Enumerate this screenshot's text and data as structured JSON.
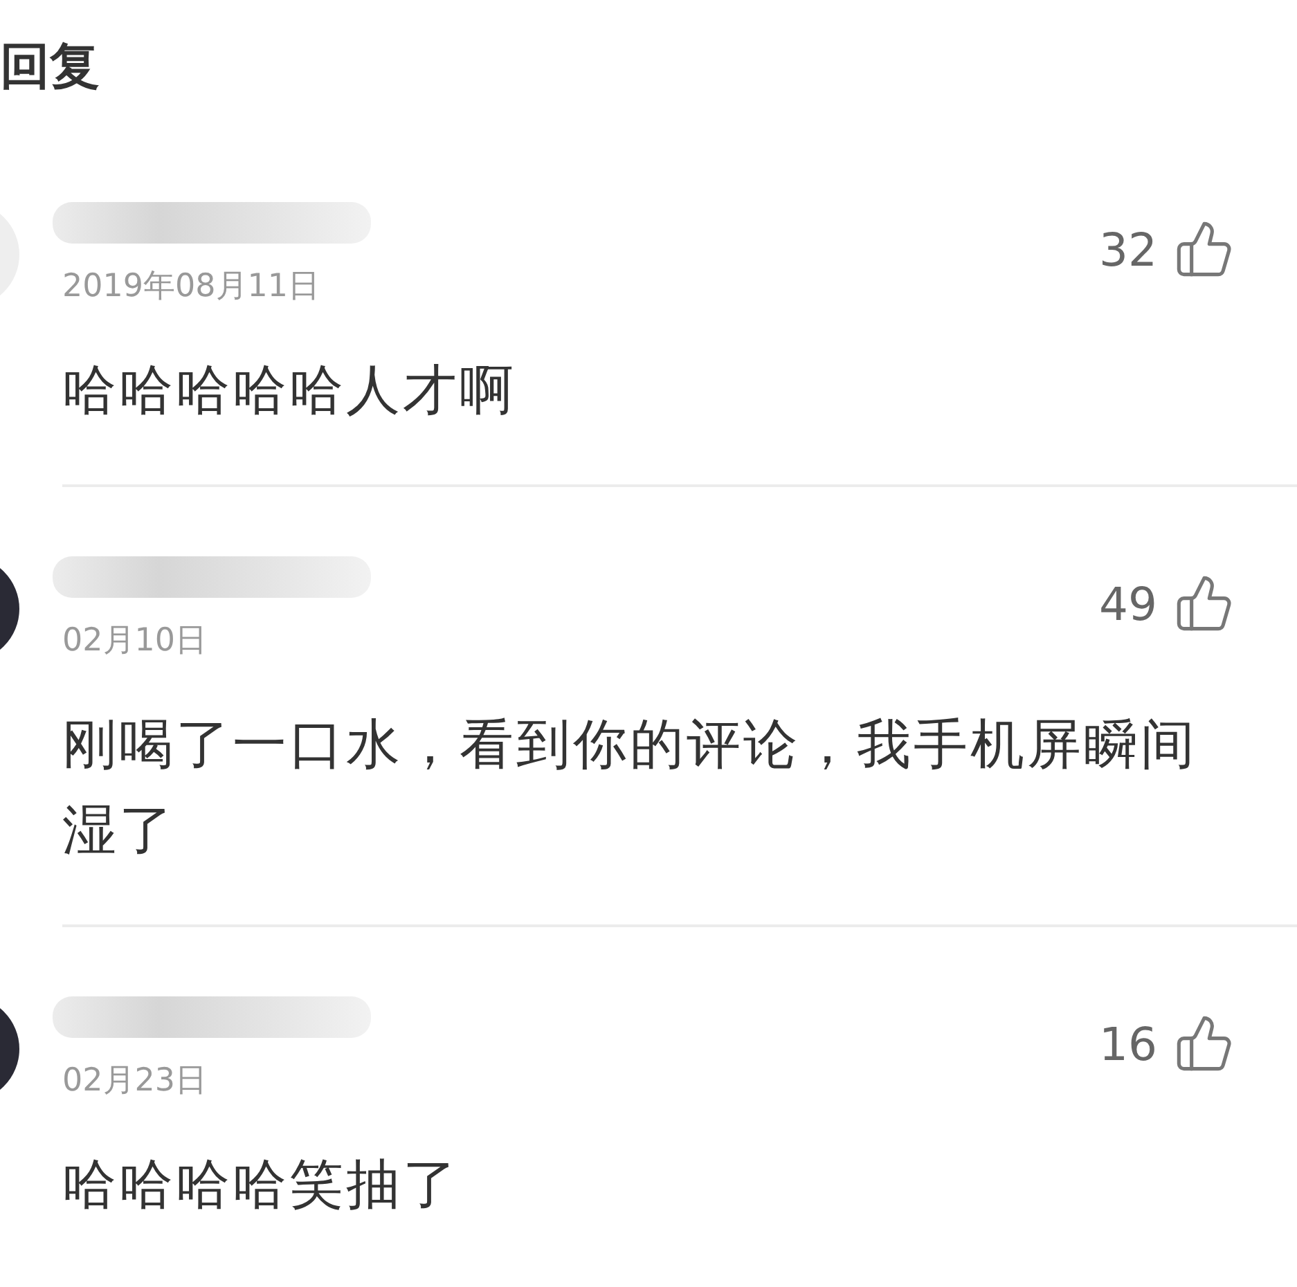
{
  "header": {
    "title": "回复"
  },
  "comments": [
    {
      "date": "2019年08月11日",
      "likes": "32",
      "text": "哈哈哈哈哈人才啊"
    },
    {
      "date": "02月10日",
      "likes": "49",
      "text": "刚喝了一口水，看到你的评论，我手机屏瞬间湿了"
    },
    {
      "date": "02月23日",
      "likes": "16",
      "text": "哈哈哈哈笑抽了"
    }
  ]
}
